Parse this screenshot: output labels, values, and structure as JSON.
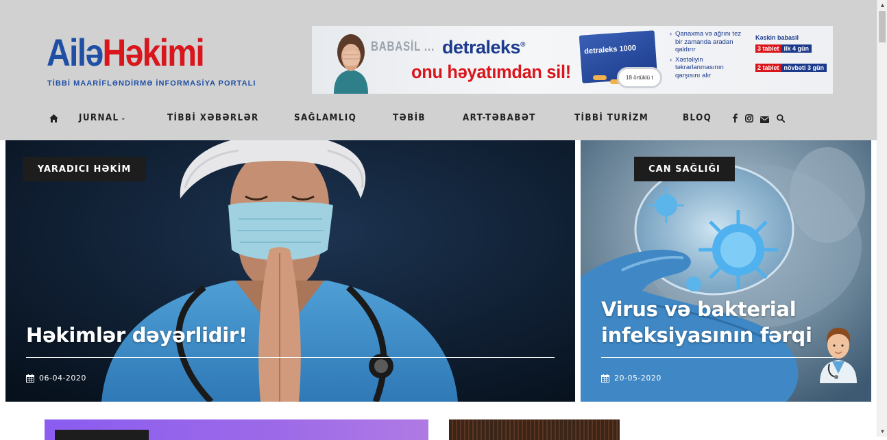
{
  "logo": {
    "part1": "Ailə",
    "part2": "Həkimi",
    "tagline": "TİBBİ MAARİFLƏNDİRMƏ İNFORMASİYA PORTALI"
  },
  "ad": {
    "brand_small": "BABASİL ...",
    "brand": "detraleks",
    "registered": "®",
    "slogan": "onu həyatımdan sil!",
    "box_label": "detraleks 1000",
    "box_sub": "18 örtüklü t",
    "bullets": [
      "Qanaxma və ağrını tez bir zamanda aradan qaldırır",
      "Xəstəliyin təkrarlanmasının qarşısını alır"
    ],
    "dosage_title": "Kəskin babasil",
    "dosage_rows": [
      {
        "tablets": "3 tablet",
        "period": "ilk 4 gün"
      },
      {
        "tablets": "2 tablet",
        "period": "növbəti 3 gün"
      }
    ]
  },
  "nav": {
    "home_icon": "home-icon",
    "items": [
      "JURNAL",
      "TİBBİ XƏBƏRLƏR",
      "SAĞLAMLIQ",
      "TƏBİB",
      "ART-TƏBABƏT",
      "TİBBİ TURİZM",
      "BLOQ"
    ],
    "caret": "⌄",
    "social_icons": [
      "facebook-icon",
      "instagram-icon",
      "envelope-icon",
      "search-icon"
    ]
  },
  "cards": [
    {
      "category": "YARADICI HƏKİM",
      "title": "Həkimlər dəyərlidir!",
      "date": "06-04-2020"
    },
    {
      "category": "CAN SAĞLIĞI",
      "title": "Virus və bakterial infeksiyasının fərqi",
      "date": "20-05-2020"
    }
  ],
  "colors": {
    "header_bg": "#d1d1d1",
    "logo_blue": "#1e4fa5",
    "logo_red": "#d9161c",
    "badge_bg": "#1d1d1d"
  }
}
